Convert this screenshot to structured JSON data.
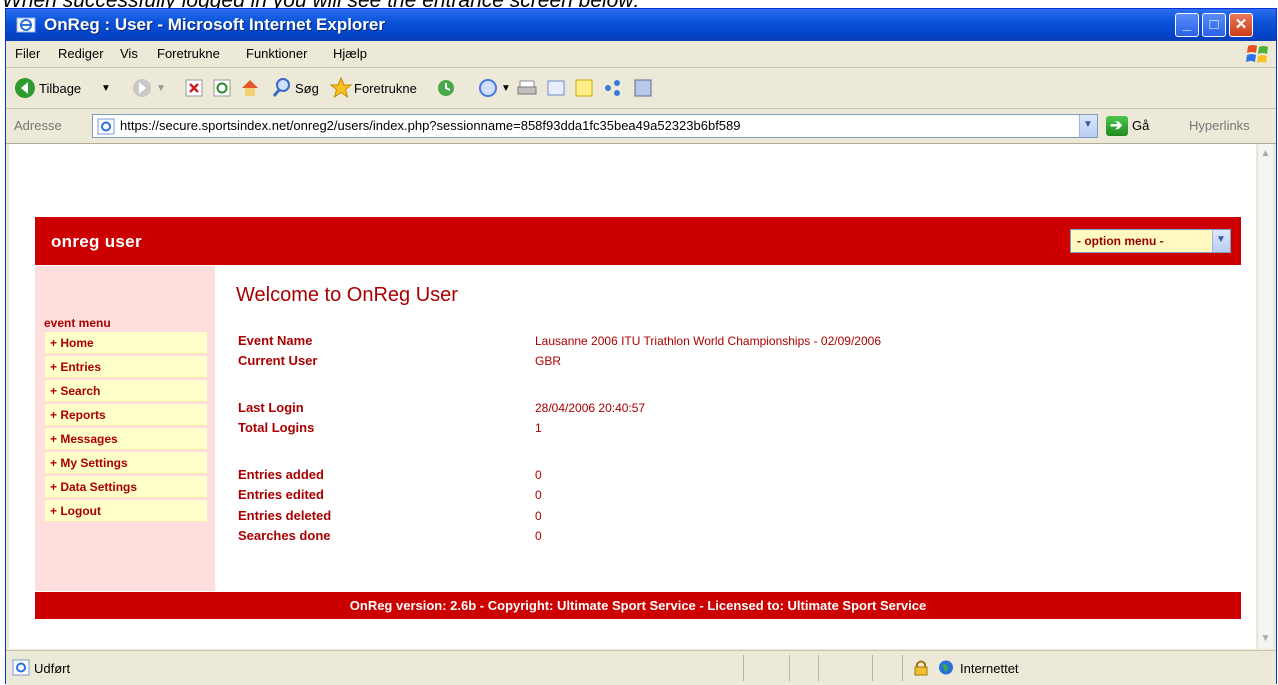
{
  "caption": "When successfully logged in you will see the entrance screen below:",
  "window": {
    "title": "OnReg : User - Microsoft Internet Explorer",
    "minimize_glyph": "_",
    "maximize_glyph": "□",
    "close_glyph": "✕"
  },
  "menubar": {
    "items": [
      "Filer",
      "Rediger",
      "Vis",
      "Foretrukne",
      "Funktioner",
      "Hjælp"
    ]
  },
  "toolbar": {
    "back_label": "Tilbage",
    "search_label": "Søg",
    "favorites_label": "Foretrukne"
  },
  "address": {
    "label": "Adresse",
    "url": "https://secure.sportsindex.net/onreg2/users/index.php?sessionname=858f93dda1fc35bea49a52323b6bf589",
    "go_label": "Gå",
    "links_label": "Hyperlinks"
  },
  "page": {
    "header_title": "onreg user",
    "option_menu": "- option menu -",
    "event_menu_heading": "event menu",
    "menu_items": [
      "+ Home",
      "+ Entries",
      "+ Search",
      "+ Reports",
      "+ Messages",
      "+ My Settings",
      "+ Data Settings",
      "+ Logout"
    ],
    "welcome": "Welcome to OnReg User",
    "info": [
      {
        "label": "Event Name",
        "value": "Lausanne 2006 ITU Triathlon World Championships - 02/09/2006"
      },
      {
        "label": "Current User",
        "value": "GBR"
      },
      {
        "label": "Last Login",
        "value": "28/04/2006 20:40:57"
      },
      {
        "label": "Total Logins",
        "value": "1"
      },
      {
        "label": "Entries added",
        "value": "0"
      },
      {
        "label": "Entries edited",
        "value": "0"
      },
      {
        "label": "Entries deleted",
        "value": "0"
      },
      {
        "label": "Searches done",
        "value": "0"
      }
    ],
    "footer": "OnReg version: 2.6b - Copyright: Ultimate Sport Service - Licensed to: Ultimate Sport Service"
  },
  "status": {
    "text": "Udført",
    "zone": "Internettet"
  },
  "colors": {
    "brand_red": "#cc0000",
    "sidebar_pink": "#ffdede",
    "menu_yellow": "#ffffcc",
    "text_red": "#aa0000"
  }
}
